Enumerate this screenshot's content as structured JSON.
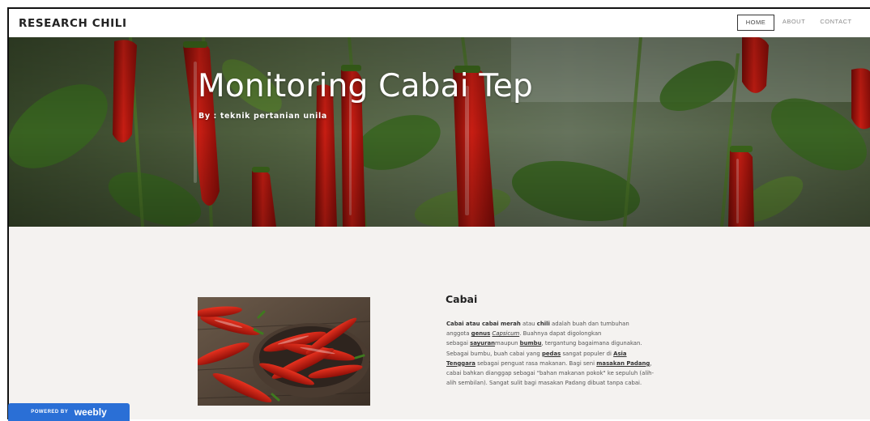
{
  "header": {
    "brand": "RESEARCH CHILI",
    "nav": [
      {
        "label": "HOME",
        "active": true
      },
      {
        "label": "ABOUT",
        "active": false
      },
      {
        "label": "CONTACT",
        "active": false
      }
    ]
  },
  "hero": {
    "title": "Monitoring Cabai Tep",
    "subtitle": "By : teknik pertanian unila"
  },
  "content": {
    "title": "Cabai",
    "lines": [
      [
        {
          "t": "Cabai atau ",
          "s": "b"
        },
        {
          "t": "cabai merah",
          "s": "b"
        },
        {
          "t": " atau ",
          "s": ""
        },
        {
          "t": "chili",
          "s": "b"
        },
        {
          "t": " adalah buah dan tumbuhan",
          "s": ""
        }
      ],
      [
        {
          "t": "anggota ",
          "s": ""
        },
        {
          "t": "genus",
          "s": "link"
        },
        {
          "t": " ",
          "s": ""
        },
        {
          "t": "Capsicum",
          "s": "link-i"
        },
        {
          "t": ". Buahnya dapat digolongkan",
          "s": ""
        }
      ],
      [
        {
          "t": "sebagai ",
          "s": ""
        },
        {
          "t": "sayuran",
          "s": "link"
        },
        {
          "t": "maupun ",
          "s": ""
        },
        {
          "t": "bumbu",
          "s": "link"
        },
        {
          "t": ", tergantung bagaimana digunakan.",
          "s": ""
        }
      ],
      [
        {
          "t": "Sebagai bumbu, buah cabai yang ",
          "s": ""
        },
        {
          "t": "pedas",
          "s": "link"
        },
        {
          "t": " sangat populer di ",
          "s": ""
        },
        {
          "t": "Asia",
          "s": "link"
        }
      ],
      [
        {
          "t": "Tenggara",
          "s": "link"
        },
        {
          "t": " sebagai penguat rasa makanan. Bagi seni ",
          "s": ""
        },
        {
          "t": "masakan Padang",
          "s": "link"
        },
        {
          "t": ",",
          "s": ""
        }
      ],
      [
        {
          "t": "cabai bahkan dianggap sebagai \"bahan makanan pokok\" ke sepuluh (alih-",
          "s": ""
        }
      ],
      [
        {
          "t": "alih sembilan). Sangat sulit bagi masakan Padang dibuat tanpa cabai.",
          "s": ""
        }
      ]
    ]
  },
  "badge": {
    "powered": "POWERED BY",
    "brand": "weebly"
  },
  "colors": {
    "badge_bg": "#2a6fd6",
    "content_bg": "#f4f2f0",
    "chili_red": "#b8150f"
  }
}
